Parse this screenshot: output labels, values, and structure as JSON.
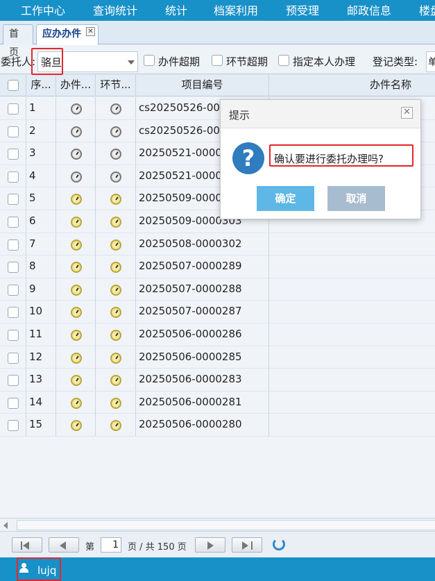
{
  "nav": {
    "items": [
      "工作中心",
      "查询统计",
      "统计",
      "档案利用",
      "预受理",
      "邮政信息",
      "楼盘"
    ]
  },
  "tabs": {
    "home": "首页",
    "active": "应办办件",
    "close": "✕"
  },
  "filter": {
    "delegate_label": "委托人:",
    "delegate_value": "骆旦",
    "overdue_label": "办件超期",
    "step_overdue_label": "环节超期",
    "assigned_label": "指定本人办理",
    "reg_type_label": "登记类型:",
    "reg_type_value": "单"
  },
  "grid": {
    "headers": {
      "seq": "序...",
      "status": "办件...",
      "step": "环节...",
      "code": "项目编号",
      "name": "办件名称"
    },
    "rows": [
      {
        "seq": "1",
        "code": "cs20250526-0000",
        "clock": "gray"
      },
      {
        "seq": "2",
        "code": "cs20250526-0000",
        "clock": "gray"
      },
      {
        "seq": "3",
        "code": "20250521-0000",
        "clock": "gray"
      },
      {
        "seq": "4",
        "code": "20250521-0000",
        "clock": "gray"
      },
      {
        "seq": "5",
        "code": "20250509-0000",
        "clock": "yellow"
      },
      {
        "seq": "6",
        "code": "20250509-0000303",
        "clock": "yellow"
      },
      {
        "seq": "7",
        "code": "20250508-0000302",
        "clock": "yellow"
      },
      {
        "seq": "8",
        "code": "20250507-0000289",
        "clock": "yellow"
      },
      {
        "seq": "9",
        "code": "20250507-0000288",
        "clock": "yellow"
      },
      {
        "seq": "10",
        "code": "20250507-0000287",
        "clock": "yellow"
      },
      {
        "seq": "11",
        "code": "20250506-0000286",
        "clock": "yellow"
      },
      {
        "seq": "12",
        "code": "20250506-0000285",
        "clock": "yellow"
      },
      {
        "seq": "13",
        "code": "20250506-0000283",
        "clock": "yellow"
      },
      {
        "seq": "14",
        "code": "20250506-0000281",
        "clock": "yellow"
      },
      {
        "seq": "15",
        "code": "20250506-0000280",
        "clock": "yellow"
      }
    ]
  },
  "pager": {
    "page_prefix": "第",
    "page": "1",
    "page_suffix": "页 / 共 150 页"
  },
  "footer": {
    "user": "lujq"
  },
  "dialog": {
    "title": "提示",
    "message": "确认要进行委托办理吗?",
    "ok": "确定",
    "cancel": "取消"
  },
  "colors": {
    "nav_bg": "#1890c8",
    "highlight": "#e5262a",
    "ok_button": "#5fb7e5",
    "cancel_button": "#a8bccf"
  }
}
